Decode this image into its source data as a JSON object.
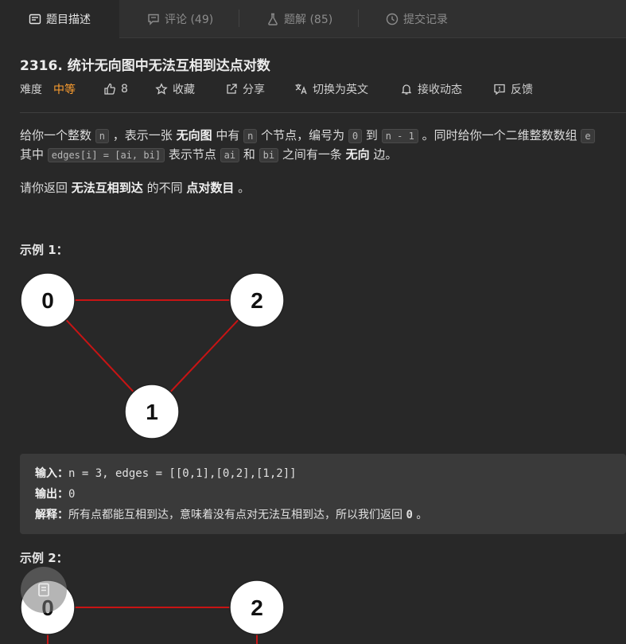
{
  "tabs": [
    {
      "label": "题目描述",
      "icon": "description-icon"
    },
    {
      "label": "评论 (49)",
      "icon": "comment-icon"
    },
    {
      "label": "题解 (85)",
      "icon": "flask-icon"
    },
    {
      "label": "提交记录",
      "icon": "history-icon"
    }
  ],
  "problem": {
    "title": "2316. 统计无向图中无法互相到达点对数",
    "difficulty_label": "难度",
    "difficulty": "中等",
    "likes": "8",
    "favorite": "收藏",
    "share": "分享",
    "switch_lang": "切换为英文",
    "subscribe": "接收动态",
    "feedback": "反馈"
  },
  "description": {
    "p1": {
      "t1": "给你一个整数 ",
      "c1": "n",
      "t2": " ，表示一张 ",
      "b1": "无向图",
      "t3": " 中有 ",
      "c2": "n",
      "t4": " 个节点，编号为 ",
      "c3": "0",
      "t5": " 到 ",
      "c4": "n - 1",
      "t6": " 。同时给你一个二维整数数组 ",
      "c5": "e"
    },
    "p2": {
      "t1": "其中 ",
      "c1": "edges[i] = [ai, bi]",
      "t2": " 表示节点 ",
      "c2": "ai",
      "t3": " 和 ",
      "c3": "bi",
      "t4": " 之间有一条 ",
      "b1": "无向",
      "t5": " 边。"
    },
    "p3": {
      "t1": "请你返回 ",
      "b1": "无法互相到达",
      "t2": " 的不同 ",
      "b2": "点对数目",
      "t3": " 。"
    }
  },
  "example1": {
    "heading": "示例 1：",
    "nodes": [
      "0",
      "2",
      "1"
    ],
    "input_label": "输入：",
    "input_value": "n = 3, edges = [[0,1],[0,2],[1,2]]",
    "output_label": "输出：",
    "output_value": "0",
    "explain_label": "解释：",
    "explain_text": "所有点都能互相到达，意味着没有点对无法互相到达，所以我们返回 ",
    "explain_code": "0",
    "explain_end": " 。"
  },
  "example2": {
    "heading": "示例 2：",
    "nodes": [
      "0",
      "2"
    ]
  },
  "colors": {
    "accent_difficulty": "#ff9f2f",
    "edge": "#c81414",
    "node_fill": "#ffffff"
  }
}
